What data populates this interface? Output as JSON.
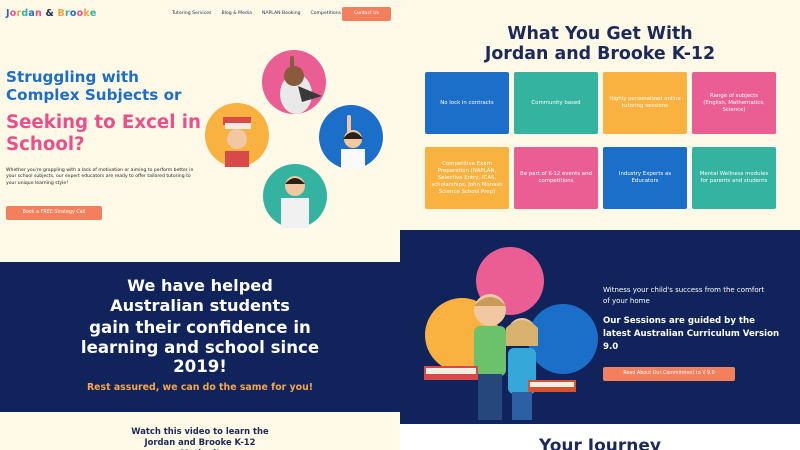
{
  "nav": {
    "logo_parts": [
      "J",
      "o",
      "r",
      "d",
      "a",
      "n",
      " ",
      "&",
      " ",
      "B",
      "r",
      "o",
      "o",
      "k",
      "e"
    ],
    "logo_colors": [
      "#1b6fc9",
      "#ea4f8a",
      "#f4a340",
      "#33b3a0",
      "#1b6fc9",
      "#ea4f8a",
      "#1c2a5a",
      "#1c2a5a",
      "#1c2a5a",
      "#f4a340",
      "#33b3a0",
      "#1b6fc9",
      "#ea4f8a",
      "#f4a340",
      "#33b3a0"
    ],
    "links": [
      "Tutoring Services",
      "Blog & Media",
      "NAPLAN Booking",
      "Competitions"
    ],
    "contact_label": "Contact Us"
  },
  "hero": {
    "heading_blue": "Struggling with Complex Subjects or",
    "heading_pink": "Seeking to Excel in School?",
    "paragraph": "Whether you're grappling with a lack of motivation or aiming to perform better in your school subjects, our expert educators are ready to offer tailored tutoring to your unique learning style!",
    "cta_label": "Book a FREE Strategy Call"
  },
  "benefits": {
    "title_line1": "What You Get With",
    "title_line2": "Jordan and Brooke K-12",
    "tiles": [
      {
        "text": "No lock in contracts",
        "color": "#1b6fc9"
      },
      {
        "text": "Community based",
        "color": "#33b3a0"
      },
      {
        "text": "Highly personalized online tutoring sessions",
        "color": "#f9b13f"
      },
      {
        "text": "Range of subjects (English, Mathematics, Science)",
        "color": "#ea5e93"
      },
      {
        "text": "Competitive Exam Preparation (NAPLAN, Selective Entry, ICAS, scholarships, John Monash Science School Prep)",
        "color": "#f9b13f"
      },
      {
        "text": "Be part of K-12 events and competitions",
        "color": "#ea5e93"
      },
      {
        "text": "Industry Experts as Educators",
        "color": "#1b6fc9"
      },
      {
        "text": "Mental Wellness modules for parents and students",
        "color": "#33b3a0"
      }
    ]
  },
  "helped": {
    "line1": "We have helped Australian students",
    "line2": "gain their confidence in learning and school since 2019!",
    "rest": "Rest assured, we can do the same for you!"
  },
  "watch": {
    "text": "Watch this video to learn the Jordan and Brooke K-12 Method!"
  },
  "curriculum": {
    "witness": "Witness your child's success from the comfort of your home",
    "sessions": "Our Sessions are guided by the latest Australian Curriculum Version 9.0",
    "cta_label": "Read About Our Commitment to V 9.0"
  },
  "journey": {
    "title": "Your Journey"
  },
  "colors": {
    "navy": "#10235a",
    "cream": "#fff9e8",
    "blue": "#1b6fc9",
    "pink": "#ea4f8a",
    "orange": "#f47f5d",
    "yellow": "#f9b13f",
    "teal": "#33b3a0"
  }
}
